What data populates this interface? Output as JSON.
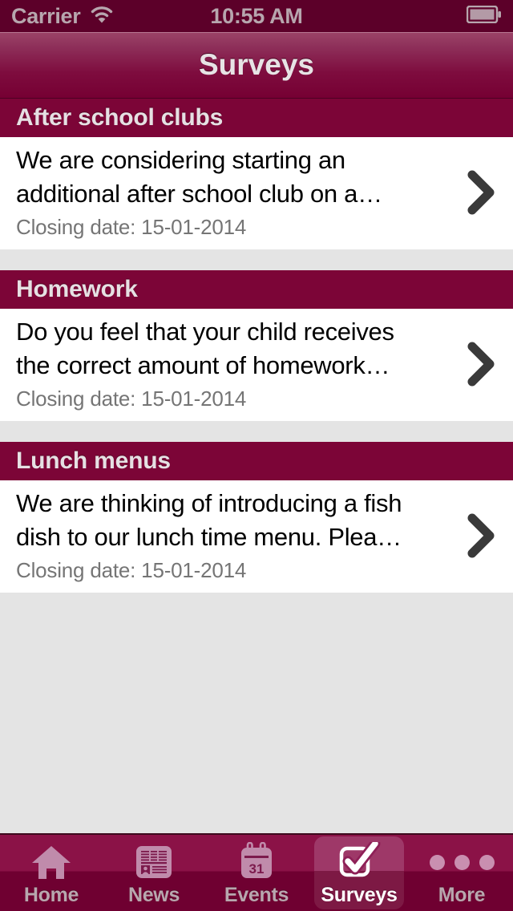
{
  "status_bar": {
    "carrier": "Carrier",
    "time": "10:55 AM",
    "wifi_icon": "wifi-icon",
    "battery_icon": "battery-icon"
  },
  "header": {
    "title": "Surveys"
  },
  "colors": {
    "brand_maroon": "#7c0537",
    "header_dark": "#760033",
    "status_bar": "#5c0029",
    "tab_bar_top": "#8b1247",
    "tab_bar_bottom": "#6f0031",
    "page_background": "#e4e4e4",
    "card_background": "#ffffff",
    "chevron": "#3a3a3a",
    "date_text": "#757575",
    "icon_inactive": "#c08bab",
    "icon_active": "#ffffff"
  },
  "surveys": [
    {
      "title": "After school clubs",
      "description": "We are considering starting an\nadditional after school club on a…",
      "closing_date": "Closing date: 15-01-2014",
      "chevron_icon": "chevron-right-icon"
    },
    {
      "title": "Homework",
      "description": "Do you feel that your child receives\nthe correct amount of homework…",
      "closing_date": "Closing date: 15-01-2014",
      "chevron_icon": "chevron-right-icon"
    },
    {
      "title": "Lunch menus",
      "description": "We are thinking of introducing a fish\ndish to our lunch time menu.  Plea…",
      "closing_date": "Closing date: 15-01-2014",
      "chevron_icon": "chevron-right-icon"
    }
  ],
  "tab_bar": {
    "active_index": 3,
    "tabs": [
      {
        "label": "Home",
        "icon": "home-icon"
      },
      {
        "label": "News",
        "icon": "newspaper-icon"
      },
      {
        "label": "Events",
        "icon": "calendar-icon",
        "calendar_day": "31"
      },
      {
        "label": "Surveys",
        "icon": "checkbox-checked-icon"
      },
      {
        "label": "More",
        "icon": "ellipsis-icon"
      }
    ]
  }
}
